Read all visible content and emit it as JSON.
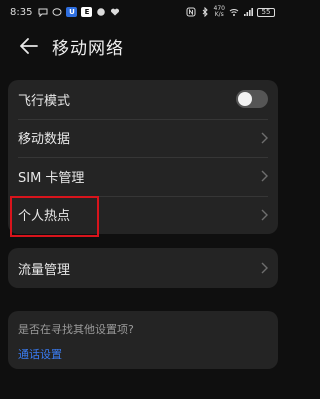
{
  "status_bar": {
    "time": "8:35",
    "network_speed_top": "470",
    "network_speed_bottom": "K/s",
    "battery": "55"
  },
  "header": {
    "title": "移动网络"
  },
  "settings": {
    "airplane_mode": {
      "label": "飞行模式",
      "enabled": false
    },
    "mobile_data": {
      "label": "移动数据"
    },
    "sim_management": {
      "label": "SIM 卡管理"
    },
    "personal_hotspot": {
      "label": "个人热点"
    }
  },
  "data_usage": {
    "label": "流量管理"
  },
  "suggestion": {
    "question": "是否在寻找其他设置项?",
    "link": "通话设置"
  },
  "colors": {
    "background": "#0f0f0f",
    "card": "#242424",
    "link": "#3a7cf2",
    "highlight": "#d8141c"
  }
}
